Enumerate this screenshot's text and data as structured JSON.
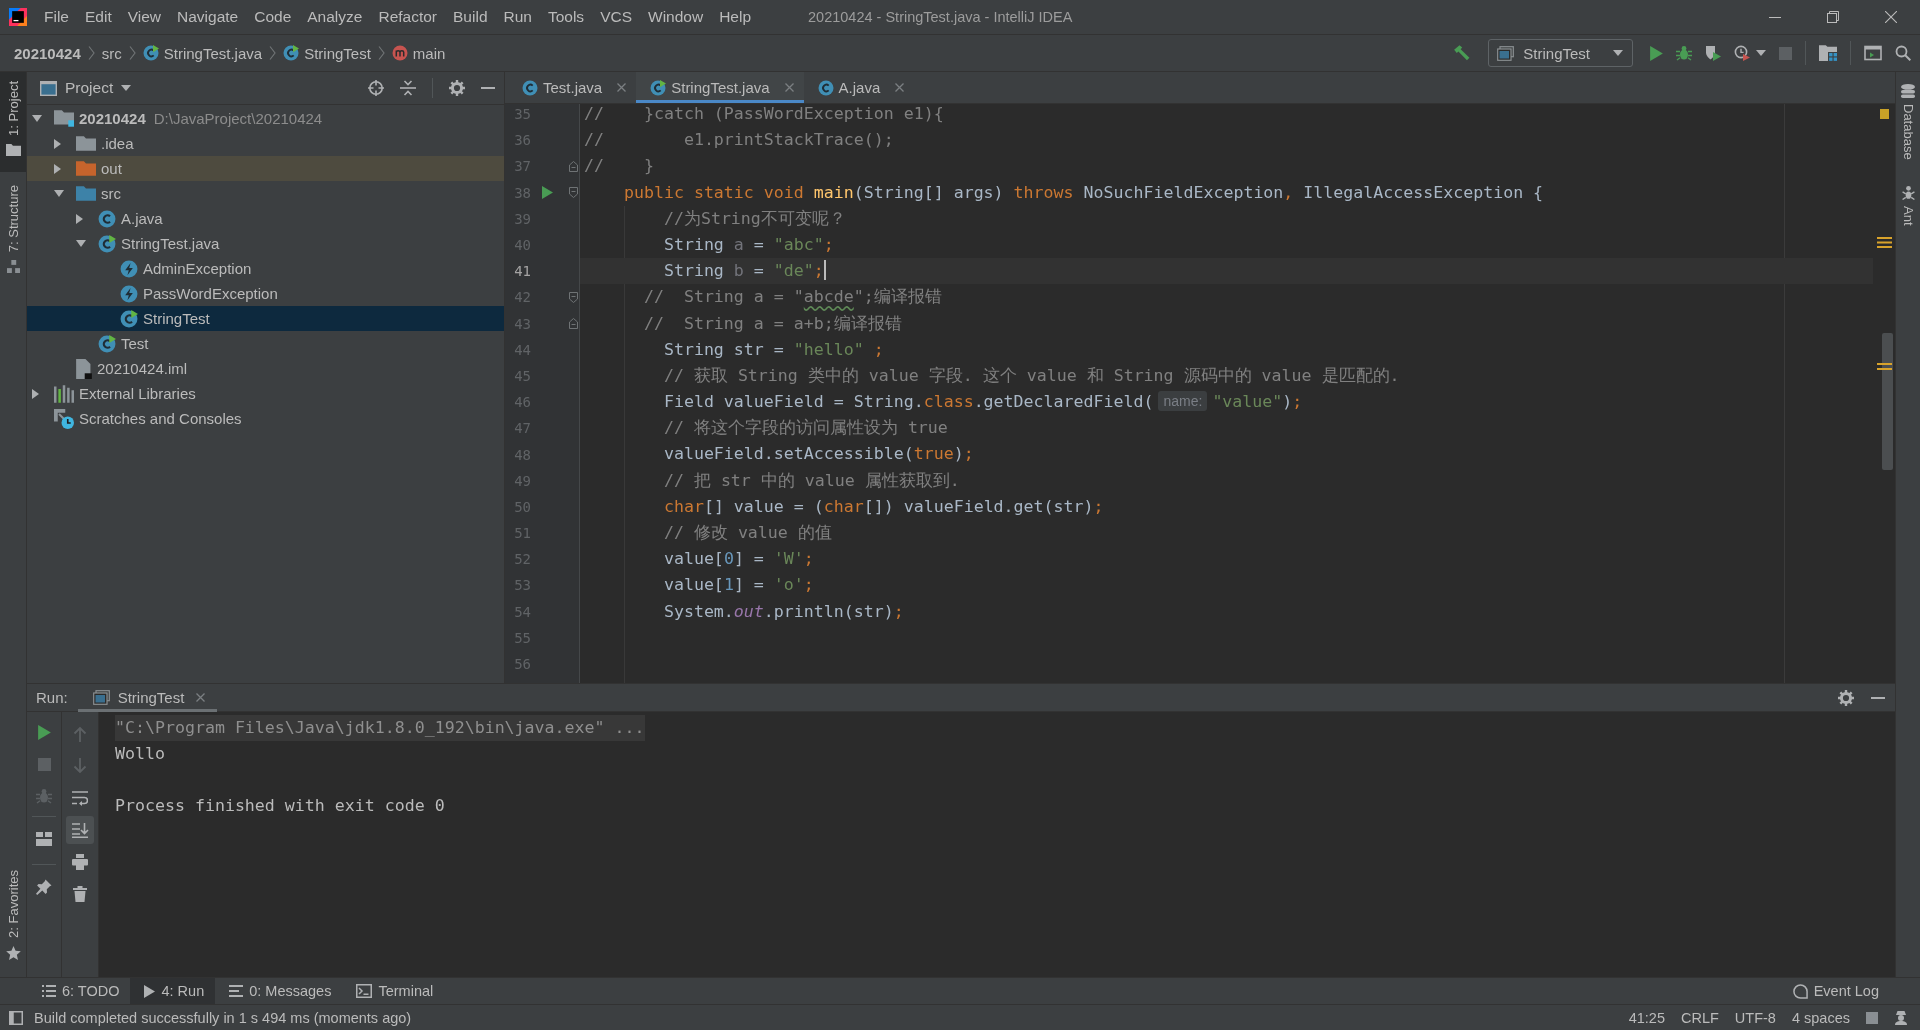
{
  "window": {
    "title": "20210424 - StringTest.java - IntelliJ IDEA"
  },
  "menu": [
    "File",
    "Edit",
    "View",
    "Navigate",
    "Code",
    "Analyze",
    "Refactor",
    "Build",
    "Run",
    "Tools",
    "VCS",
    "Window",
    "Help"
  ],
  "breadcrumbs": [
    {
      "label": "20210424",
      "kind": "project"
    },
    {
      "label": "src",
      "kind": "directory"
    },
    {
      "label": "StringTest.java",
      "kind": "runnable_class"
    },
    {
      "label": "StringTest",
      "kind": "runnable_class"
    },
    {
      "label": "main",
      "kind": "method"
    }
  ],
  "toolbar": [
    {
      "kind": "build",
      "disabled": false
    },
    {
      "kind": "run_config",
      "label": "StringTest",
      "disabled": false
    },
    {
      "kind": "run",
      "disabled": false
    },
    {
      "kind": "debug",
      "disabled": false
    },
    {
      "kind": "coverage",
      "disabled": false
    },
    {
      "kind": "profile",
      "disabled": false
    },
    {
      "kind": "stop",
      "disabled": true
    },
    {
      "kind": "project_structure",
      "disabled": false
    },
    {
      "kind": "presentation",
      "disabled": false
    },
    {
      "kind": "search",
      "disabled": false
    }
  ],
  "left_strip": {
    "top": [
      {
        "label": "1: Project",
        "kind": "project",
        "selected": true
      },
      {
        "label": "7: Structure",
        "kind": "structure",
        "selected": false
      }
    ],
    "bottom": [
      {
        "label": "2: Favorites",
        "kind": "favorites",
        "selected": false
      }
    ]
  },
  "right_strip": [
    {
      "label": "Database",
      "kind": "database"
    },
    {
      "label": "Ant",
      "kind": "ant"
    }
  ],
  "project_panel": {
    "title": "Project",
    "tree": [
      {
        "label": "20210424",
        "detail": "D:\\JavaProject\\20210424",
        "kind": "module",
        "expanded": true,
        "selected": false,
        "children": [
          {
            "label": ".idea",
            "kind": "folder",
            "expanded": false,
            "selected": false
          },
          {
            "label": "out",
            "kind": "excluded_folder",
            "expanded": false,
            "selected": false
          },
          {
            "label": "src",
            "kind": "source_folder",
            "expanded": true,
            "selected": false,
            "children": [
              {
                "label": "A.java",
                "kind": "class",
                "expanded": false,
                "selected": false
              },
              {
                "label": "StringTest.java",
                "kind": "runnable_class",
                "expanded": true,
                "selected": false,
                "children": [
                  {
                    "label": "AdminException",
                    "kind": "exception",
                    "selected": false
                  },
                  {
                    "label": "PassWordException",
                    "kind": "exception",
                    "selected": false
                  },
                  {
                    "label": "StringTest",
                    "kind": "runnable_class",
                    "selected": true
                  }
                ]
              },
              {
                "label": "Test",
                "kind": "runnable_class",
                "selected": false
              }
            ]
          },
          {
            "label": "20210424.iml",
            "kind": "module_file",
            "selected": false
          }
        ]
      },
      {
        "label": "External Libraries",
        "kind": "libraries",
        "expanded": false,
        "selected": false
      },
      {
        "label": "Scratches and Consoles",
        "kind": "scratches",
        "selected": false
      }
    ]
  },
  "editor": {
    "tabs": [
      {
        "label": "Test.java",
        "kind": "class",
        "selected": false
      },
      {
        "label": "StringTest.java",
        "kind": "runnable_class",
        "selected": true
      },
      {
        "label": "A.java",
        "kind": "class",
        "selected": false
      }
    ],
    "lines": [
      {
        "number": "35",
        "current": false,
        "tokens": [
          {
            "kind": "comment",
            "text": "//    }catch (PassWordException e1){"
          }
        ]
      },
      {
        "number": "36",
        "current": false,
        "tokens": [
          {
            "kind": "comment",
            "text": "//        e1.printStackTrace();"
          }
        ]
      },
      {
        "number": "37",
        "current": false,
        "fold_end": true,
        "tokens": [
          {
            "kind": "comment",
            "text": "//    }"
          }
        ]
      },
      {
        "number": "38",
        "current": false,
        "run": true,
        "fold_start": true,
        "tokens": [
          {
            "kind": "keyword",
            "text": "    public static void "
          },
          {
            "kind": "method",
            "text": "main"
          },
          {
            "kind": "plain",
            "text": "(String[] args) "
          },
          {
            "kind": "keyword",
            "text": "throws "
          },
          {
            "kind": "plain",
            "text": "NoSuchFieldException"
          },
          {
            "kind": "keyword",
            "text": ", "
          },
          {
            "kind": "plain",
            "text": "IllegalAccessException {"
          }
        ]
      },
      {
        "number": "39",
        "current": false,
        "tokens": [
          {
            "kind": "comment",
            "text": "        //为String不可变呢？"
          }
        ]
      },
      {
        "number": "40",
        "current": false,
        "tokens": [
          {
            "kind": "plain",
            "text": "        String "
          },
          {
            "kind": "unused",
            "text": "a"
          },
          {
            "kind": "plain",
            "text": " = "
          },
          {
            "kind": "string",
            "text": "\"abc\""
          },
          {
            "kind": "keyword",
            "text": ";"
          }
        ]
      },
      {
        "number": "41",
        "current": true,
        "tokens": [
          {
            "kind": "plain",
            "text": "        String "
          },
          {
            "kind": "unused",
            "text": "b"
          },
          {
            "kind": "plain",
            "text": " = "
          },
          {
            "kind": "string",
            "text": "\"de\""
          },
          {
            "kind": "keyword",
            "text": ";"
          }
        ]
      },
      {
        "number": "42",
        "current": false,
        "fold_start": true,
        "tokens": [
          {
            "kind": "comment",
            "text": "      //  String a = \""
          },
          {
            "kind": "comment_typo",
            "text": "abcde"
          },
          {
            "kind": "comment",
            "text": "\";编译报错"
          }
        ]
      },
      {
        "number": "43",
        "current": false,
        "fold_end": true,
        "tokens": [
          {
            "kind": "comment",
            "text": "      //  String a = a+b;编译报错"
          }
        ]
      },
      {
        "number": "44",
        "current": false,
        "tokens": [
          {
            "kind": "plain",
            "text": "        String str = "
          },
          {
            "kind": "string",
            "text": "\"hello\""
          },
          {
            "kind": "keyword",
            "text": " ;"
          }
        ]
      },
      {
        "number": "45",
        "current": false,
        "tokens": [
          {
            "kind": "comment",
            "text": "        // 获取 String 类中的 value 字段. 这个 value 和 String 源码中的 value 是匹配的."
          }
        ]
      },
      {
        "number": "46",
        "current": false,
        "tokens": [
          {
            "kind": "plain",
            "text": "        Field valueField = String."
          },
          {
            "kind": "keyword",
            "text": "class"
          },
          {
            "kind": "plain",
            "text": ".getDeclaredField("
          },
          {
            "kind": "hint",
            "text": "name:"
          },
          {
            "kind": "string",
            "text": "\"value\""
          },
          {
            "kind": "plain",
            "text": ")"
          },
          {
            "kind": "keyword",
            "text": ";"
          }
        ]
      },
      {
        "number": "47",
        "current": false,
        "tokens": [
          {
            "kind": "comment",
            "text": "        // 将这个字段的访问属性设为 true"
          }
        ]
      },
      {
        "number": "48",
        "current": false,
        "tokens": [
          {
            "kind": "plain",
            "text": "        valueField.setAccessible("
          },
          {
            "kind": "keyword",
            "text": "true"
          },
          {
            "kind": "plain",
            "text": ")"
          },
          {
            "kind": "keyword",
            "text": ";"
          }
        ]
      },
      {
        "number": "49",
        "current": false,
        "tokens": [
          {
            "kind": "comment",
            "text": "        // 把 str 中的 value 属性获取到."
          }
        ]
      },
      {
        "number": "50",
        "current": false,
        "tokens": [
          {
            "kind": "keyword",
            "text": "        char"
          },
          {
            "kind": "plain",
            "text": "[] value = ("
          },
          {
            "kind": "keyword",
            "text": "char"
          },
          {
            "kind": "plain",
            "text": "[]) valueField.get(str)"
          },
          {
            "kind": "keyword",
            "text": ";"
          }
        ]
      },
      {
        "number": "51",
        "current": false,
        "tokens": [
          {
            "kind": "comment",
            "text": "        // 修改 value 的值"
          }
        ]
      },
      {
        "number": "52",
        "current": false,
        "tokens": [
          {
            "kind": "plain",
            "text": "        value["
          },
          {
            "kind": "number",
            "text": "0"
          },
          {
            "kind": "plain",
            "text": "] = "
          },
          {
            "kind": "string",
            "text": "'W'"
          },
          {
            "kind": "keyword",
            "text": ";"
          }
        ]
      },
      {
        "number": "53",
        "current": false,
        "tokens": [
          {
            "kind": "plain",
            "text": "        value["
          },
          {
            "kind": "number",
            "text": "1"
          },
          {
            "kind": "plain",
            "text": "] = "
          },
          {
            "kind": "string",
            "text": "'o'"
          },
          {
            "kind": "keyword",
            "text": ";"
          }
        ]
      },
      {
        "number": "54",
        "current": false,
        "tokens": [
          {
            "kind": "plain",
            "text": "        System."
          },
          {
            "kind": "static_field",
            "text": "out"
          },
          {
            "kind": "plain",
            "text": ".println(str)"
          },
          {
            "kind": "keyword",
            "text": ";"
          }
        ]
      },
      {
        "number": "55",
        "current": false
      },
      {
        "number": "56",
        "current": false
      }
    ]
  },
  "run_panel": {
    "title": "Run:",
    "tabs": [
      {
        "label": "StringTest",
        "selected": true
      }
    ],
    "actions": [
      {
        "kind": "rerun",
        "disabled": false
      },
      {
        "kind": "stop",
        "disabled": true
      },
      {
        "kind": "debug_rerun",
        "disabled": true
      },
      {
        "kind": "restore_layout",
        "disabled": false
      },
      {
        "kind": "pin",
        "disabled": false
      }
    ],
    "output_actions": [
      {
        "kind": "previous",
        "disabled": true,
        "on": false
      },
      {
        "kind": "next",
        "disabled": true,
        "on": false
      },
      {
        "kind": "soft_wrap",
        "disabled": false,
        "on": false
      },
      {
        "kind": "scroll_to_end",
        "disabled": false,
        "on": true
      },
      {
        "kind": "print",
        "disabled": false,
        "on": false
      },
      {
        "kind": "clear",
        "disabled": false,
        "on": false
      }
    ],
    "console": [
      {
        "kind": "command",
        "text": "\"C:\\Program Files\\Java\\jdk1.8.0_192\\bin\\java.exe\" ..."
      },
      {
        "kind": "output",
        "text": "Wollo"
      },
      {
        "kind": "exit",
        "text": "Process finished with exit code 0"
      }
    ]
  },
  "tool_window_bar": {
    "items": [
      {
        "label": "6: TODO",
        "kind": "todo",
        "selected": false
      },
      {
        "label": "4: Run",
        "kind": "run",
        "selected": true
      },
      {
        "label": "0: Messages",
        "kind": "messages",
        "selected": false
      },
      {
        "label": "Terminal",
        "kind": "terminal",
        "selected": false
      }
    ],
    "event_log": "Event Log"
  },
  "status_bar": {
    "message": "Build completed successfully in 1 s 494 ms (moments ago)",
    "position": "41:25",
    "line_separator": "CRLF",
    "encoding": "UTF-8",
    "indent": "4 spaces"
  }
}
